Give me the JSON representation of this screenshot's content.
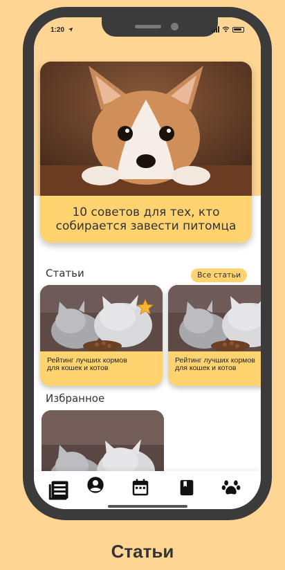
{
  "status_bar": {
    "time": "1:20"
  },
  "hero": {
    "title": "10 советов для тех, кто собирается завести питомца"
  },
  "articles": {
    "title": "Статьи",
    "all_label": "Все статьи",
    "items": [
      {
        "title_line1": "Рейтинг лучших кормов",
        "title_line2": "для кошек и котов",
        "favorite": true
      },
      {
        "title_line1": "Рейтинг лучших кормов",
        "title_line2": "для кошек и котов",
        "favorite": false
      }
    ]
  },
  "favorites": {
    "title": "Избранное"
  },
  "bottom_nav": {
    "items": [
      {
        "icon": "newspaper-icon",
        "active": true
      },
      {
        "icon": "user-icon",
        "active": false
      },
      {
        "icon": "calendar-icon",
        "active": false
      },
      {
        "icon": "book-icon",
        "active": false
      },
      {
        "icon": "paw-icon",
        "active": false
      }
    ]
  },
  "caption": "Статьи",
  "colors": {
    "background": "#FFD593",
    "accent": "#FFD36F",
    "frame": "#3B3B3B",
    "text": "#333333"
  }
}
